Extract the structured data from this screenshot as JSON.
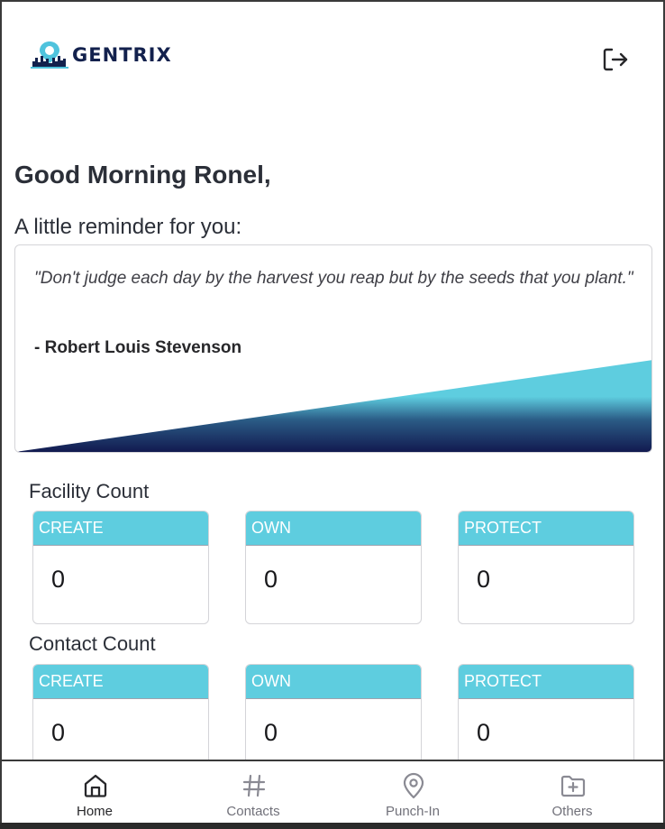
{
  "app": {
    "brand": "GENTRIX",
    "colors": {
      "brand_navy": "#13214d",
      "accent_cyan": "#5ecddf",
      "text_dark": "#2b2f38"
    }
  },
  "header": {
    "logo_icon": "location-pin-skyline-icon",
    "logout_icon": "logout-icon"
  },
  "greeting": "Good Morning Ronel,",
  "reminder": {
    "title": "A little reminder for you:",
    "quote": "\"Don't judge each day by the harvest you reap but by the seeds that you plant.\"",
    "author": "- Robert Louis Stevenson"
  },
  "facility_count": {
    "title": "Facility Count",
    "cards": [
      {
        "label": "CREATE",
        "value": "0"
      },
      {
        "label": "OWN",
        "value": "0"
      },
      {
        "label": "PROTECT",
        "value": "0"
      }
    ]
  },
  "contact_count": {
    "title": "Contact Count",
    "cards": [
      {
        "label": "CREATE",
        "value": "0"
      },
      {
        "label": "OWN",
        "value": "0"
      },
      {
        "label": "PROTECT",
        "value": "0"
      }
    ]
  },
  "nav": {
    "items": [
      {
        "label": "Home",
        "icon": "home-icon",
        "active": true
      },
      {
        "label": "Contacts",
        "icon": "hash-icon",
        "active": false
      },
      {
        "label": "Punch-In",
        "icon": "map-pin-icon",
        "active": false
      },
      {
        "label": "Others",
        "icon": "folder-plus-icon",
        "active": false
      }
    ]
  }
}
